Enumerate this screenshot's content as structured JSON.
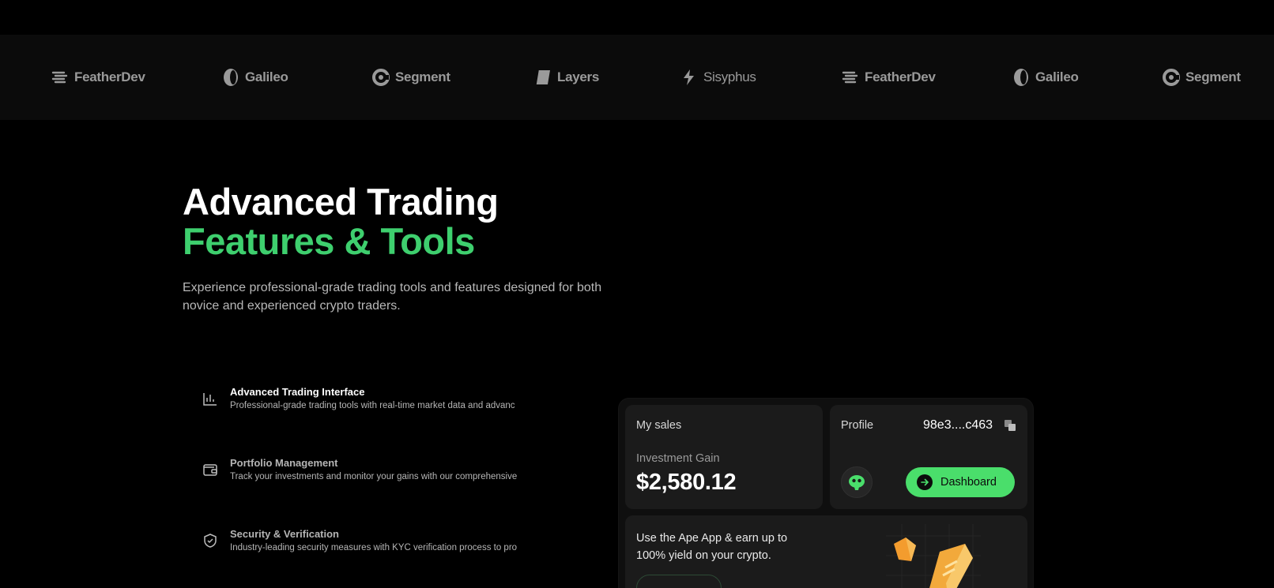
{
  "logos": [
    {
      "name": "FeatherDev",
      "icon": "feather-stack-icon"
    },
    {
      "name": "Galileo",
      "icon": "galileo-oval-icon"
    },
    {
      "name": "Segment",
      "icon": "segment-arc-icon"
    },
    {
      "name": "Layers",
      "icon": "layers-icon"
    },
    {
      "name": "Sisyphus",
      "icon": "bolt-icon"
    },
    {
      "name": "FeatherDev",
      "icon": "feather-stack-icon"
    },
    {
      "name": "Galileo",
      "icon": "galileo-oval-icon"
    },
    {
      "name": "Segment",
      "icon": "segment-arc-icon"
    }
  ],
  "hero": {
    "title_line1": "Advanced Trading",
    "title_line2": "Features & Tools",
    "subtitle": "Experience professional-grade trading tools and features designed for both novice and experienced crypto traders."
  },
  "features": [
    {
      "title": "Advanced Trading Interface",
      "description": "Professional-grade trading tools with real-time market data and advanc",
      "icon": "bar-chart-icon"
    },
    {
      "title": "Portfolio Management",
      "description": "Track your investments and monitor your gains with our comprehensive",
      "icon": "wallet-icon"
    },
    {
      "title": "Security & Verification",
      "description": "Industry-leading security measures with KYC verification process to pro",
      "icon": "shield-check-icon"
    }
  ],
  "app": {
    "sales_label": "My sales",
    "gain_label": "Investment Gain",
    "gain_value": "$2,580.12",
    "profile_label": "Profile",
    "wallet_address": "98e3....c463",
    "dashboard_label": "Dashboard",
    "promo_text": "Use the Ape App & earn up to 100% yield on your crypto."
  },
  "colors": {
    "accent_green": "#3ecf6e",
    "button_green": "#4ade6b",
    "background": "#000000"
  }
}
